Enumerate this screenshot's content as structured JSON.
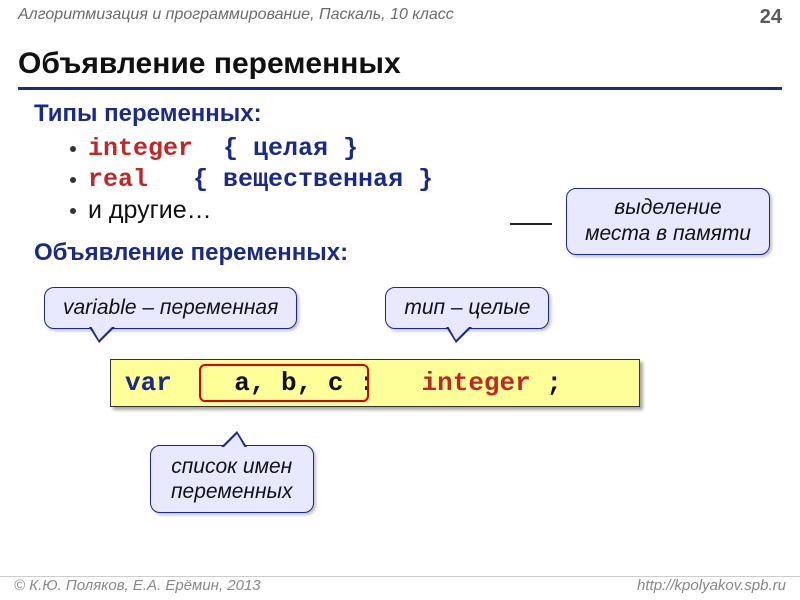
{
  "header": {
    "course": "Алгоритмизация и программирование, Паскаль, 10 класс",
    "page": "24"
  },
  "title": "Объявление переменных",
  "types": {
    "label": "Типы переменных:",
    "items": [
      {
        "keyword": "integer",
        "comment": "{ целая }"
      },
      {
        "keyword": "real",
        "comment": "{ вещественная }"
      }
    ],
    "etc": "и другие…"
  },
  "declaration": {
    "label": "Объявление переменных:",
    "memory_note": "выделение\nместа в памяти",
    "callout_variable": "variable – переменная",
    "callout_type": "тип – целые",
    "callout_list": "список имен\nпеременных",
    "code": {
      "kw1": "var",
      "vars": "a, b, c",
      "colon": ":",
      "kw2": "integer",
      "semi": ";"
    }
  },
  "footer": {
    "authors": "К.Ю. Поляков, Е.А. Ерёмин, 2013",
    "url": "http://kpolyakov.spb.ru"
  }
}
